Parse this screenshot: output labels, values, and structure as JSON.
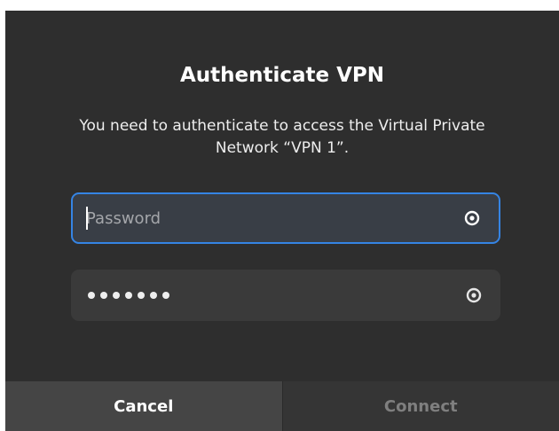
{
  "dialog": {
    "title": "Authenticate VPN",
    "message": "You need to authenticate to access the Virtual Private Network “VPN 1”.",
    "fields": [
      {
        "placeholder": "Password",
        "value": "",
        "focused": true,
        "reveal_icon": "eye-icon"
      },
      {
        "placeholder": "",
        "value": "•••••••",
        "masked_length": 7,
        "focused": false,
        "reveal_icon": "eye-icon"
      }
    ],
    "buttons": {
      "cancel_label": "Cancel",
      "connect_label": "Connect"
    }
  },
  "colors": {
    "dialog_bg": "#2e2e2e",
    "accent": "#3584e4",
    "text_primary": "#ffffff",
    "text_disabled": "#7f7f7f"
  }
}
